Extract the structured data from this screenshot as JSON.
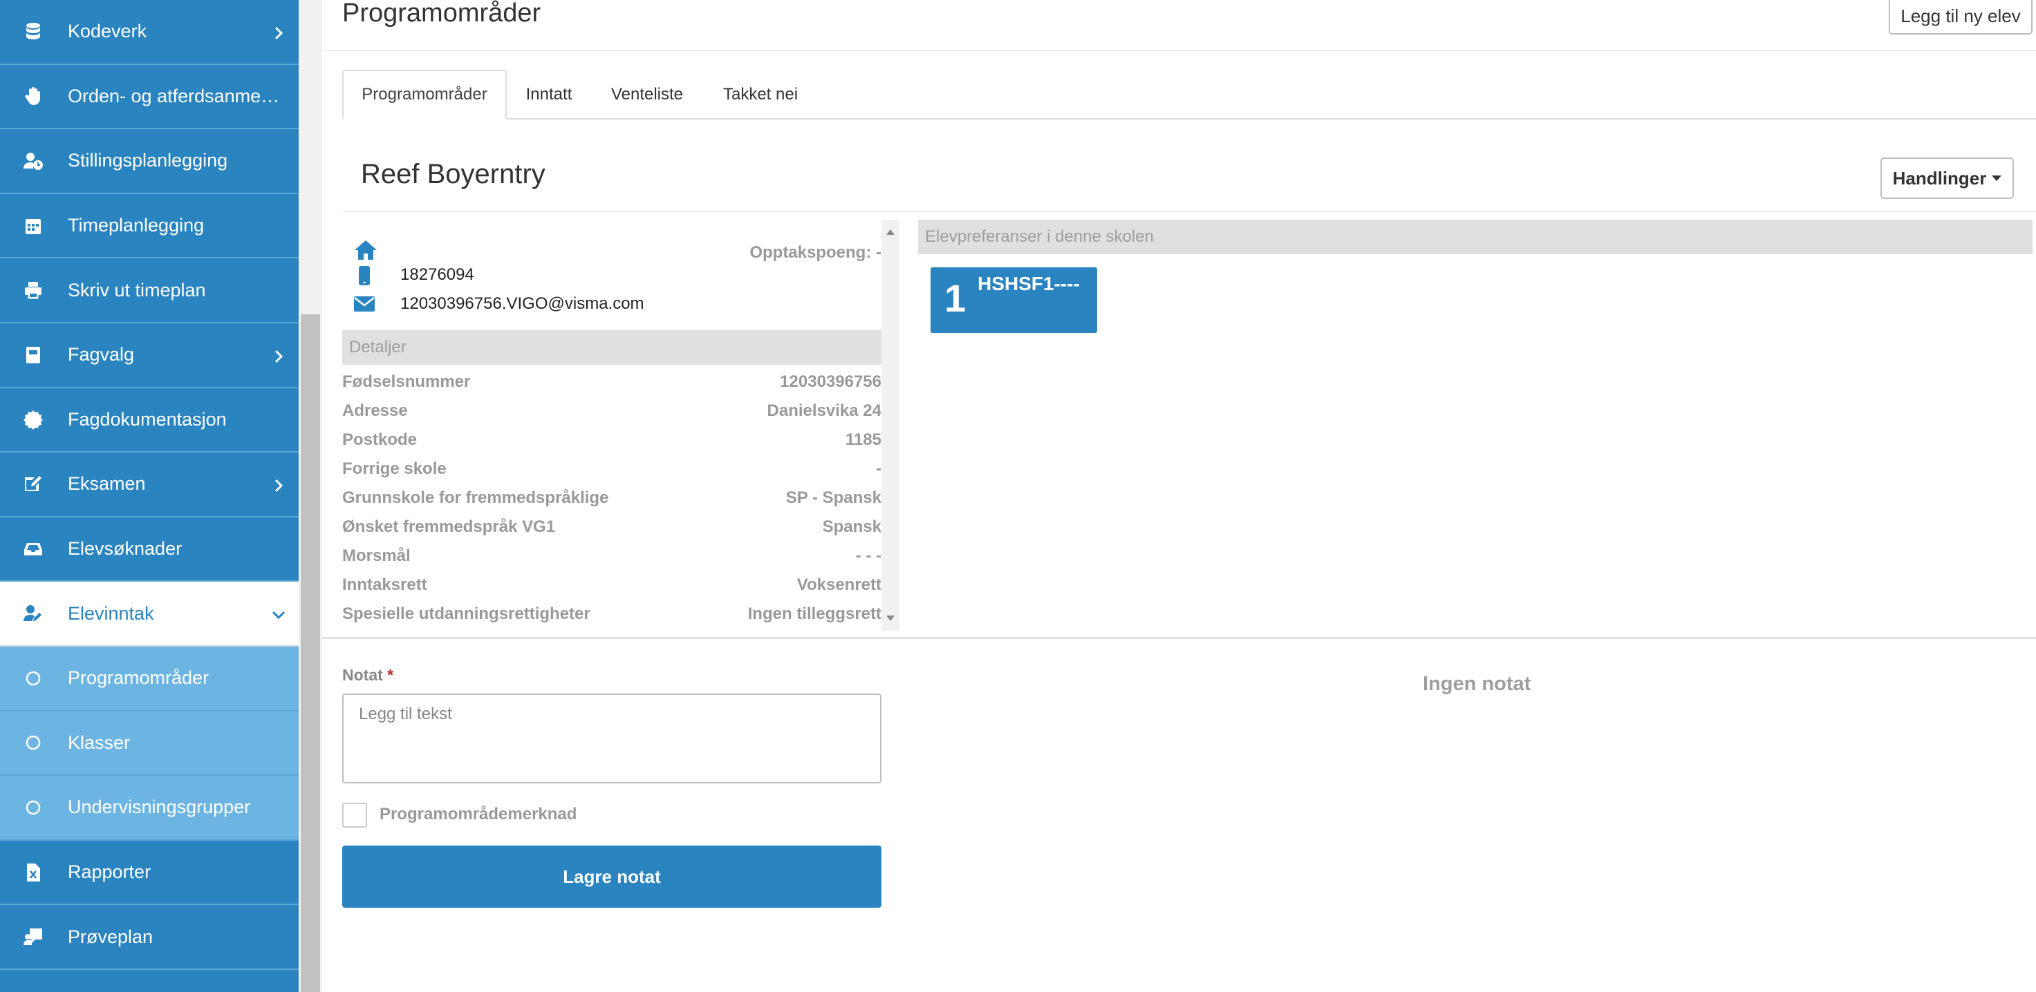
{
  "sidebar": {
    "items": [
      {
        "label": "Kodeverk",
        "icon": "database-icon",
        "chevron": "right"
      },
      {
        "label": "Orden- og atferdsanmerkninger",
        "icon": "hand-icon",
        "chevron": ""
      },
      {
        "label": "Stillingsplanlegging",
        "icon": "user-clock-icon",
        "chevron": ""
      },
      {
        "label": "Timeplanlegging",
        "icon": "calendar-icon",
        "chevron": ""
      },
      {
        "label": "Skriv ut timeplan",
        "icon": "printer-icon",
        "chevron": ""
      },
      {
        "label": "Fagvalg",
        "icon": "book-icon",
        "chevron": "right"
      },
      {
        "label": "Fagdokumentasjon",
        "icon": "certificate-icon",
        "chevron": ""
      },
      {
        "label": "Eksamen",
        "icon": "signature-icon",
        "chevron": "right"
      },
      {
        "label": "Elevsøknader",
        "icon": "inbox-icon",
        "chevron": ""
      },
      {
        "label": "Elevinntak",
        "icon": "user-edit-icon",
        "chevron": "down",
        "active": true
      },
      {
        "label": "Programområder",
        "icon": "circle-icon",
        "chevron": "",
        "sub": true
      },
      {
        "label": "Klasser",
        "icon": "circle-icon",
        "chevron": "",
        "sub": true
      },
      {
        "label": "Undervisningsgrupper",
        "icon": "circle-icon",
        "chevron": "",
        "sub": true
      },
      {
        "label": "Rapporter",
        "icon": "excel-file-icon",
        "chevron": ""
      },
      {
        "label": "Prøveplan",
        "icon": "chalkboard-teacher-icon",
        "chevron": ""
      }
    ]
  },
  "header": {
    "title": "Programområder",
    "add_button": "Legg til ny elev"
  },
  "tabs": [
    {
      "label": "Programområder",
      "active": true
    },
    {
      "label": "Inntatt"
    },
    {
      "label": "Venteliste"
    },
    {
      "label": "Takket nei"
    }
  ],
  "student": {
    "name": "Reef Boyerntry",
    "actions_label": "Handlinger",
    "opptakspoeng": "Opptakspoeng: -",
    "phone": "18276094",
    "email": "12030396756.VIGO@visma.com"
  },
  "details": {
    "header": "Detaljer",
    "rows": [
      {
        "label": "Fødselsnummer",
        "value": "12030396756"
      },
      {
        "label": "Adresse",
        "value": "Danielsvika 24"
      },
      {
        "label": "Postkode",
        "value": "1185"
      },
      {
        "label": "Forrige skole",
        "value": "-"
      },
      {
        "label": "Grunnskole for fremmedspråklige",
        "value": "SP - Spansk"
      },
      {
        "label": "Ønsket fremmedspråk VG1",
        "value": "Spansk"
      },
      {
        "label": "Morsmål",
        "value": "- - -"
      },
      {
        "label": "Inntaksrett",
        "value": "Voksenrett"
      },
      {
        "label": "Spesielle utdanningsrettigheter",
        "value": "Ingen tilleggsrett"
      }
    ]
  },
  "preferences": {
    "header": "Elevpreferanser i denne skolen",
    "items": [
      {
        "rank": "1",
        "code": "HSHSF1----"
      }
    ]
  },
  "note": {
    "label": "Notat",
    "required_mark": "*",
    "placeholder": "Legg til tekst",
    "checkbox_label": "Programområdemerknad",
    "save_button": "Lagre notat",
    "empty_text": "Ingen notat"
  },
  "colors": {
    "primary": "#2a84c0",
    "sub_item": "#6cb5e2"
  }
}
